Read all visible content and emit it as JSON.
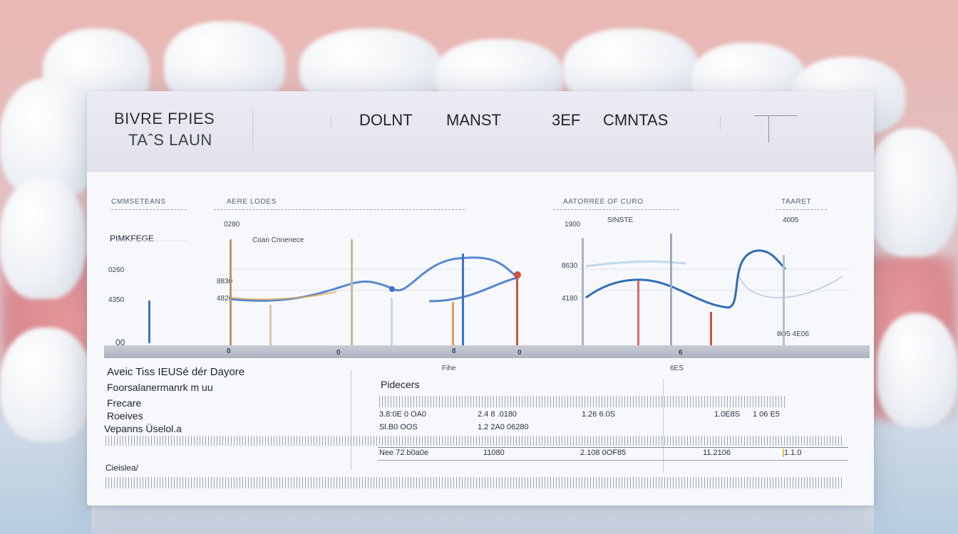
{
  "header": {
    "title_line1": "BIVRE FPIES",
    "title_line2": "TAˆS LAUN",
    "menu": [
      "DOLNT",
      "MANST",
      "3EF",
      "CMNTAS"
    ]
  },
  "panels": [
    {
      "heading": "CMMSETEANS",
      "sub": "PIMKFEGE",
      "ticks": [
        "0260",
        "4350",
        "00"
      ],
      "bottom": "0"
    },
    {
      "heading": "AERE LODES",
      "sub": "Coan Cnnenece",
      "ticks": [
        "0280",
        "8830",
        "4826"
      ],
      "bottom": "6"
    },
    {
      "heading": "AATORREE OF CURO",
      "sub": "SINSTE",
      "ticks": [
        "1900",
        "8630",
        "4180"
      ],
      "bottom": "8"
    },
    {
      "heading": "TAARET",
      "sub": "4005",
      "ticks": [
        "8O5 4E06"
      ],
      "bottom": ""
    }
  ],
  "axis_labels": [
    "0",
    "0",
    "8",
    "0",
    "6"
  ],
  "caption_mid": "Fihe",
  "caption_right": "6ES",
  "side_labels": {
    "line1": "Aveic Tiss IEUSé dér Dayore",
    "line2": "Foorsalanermanrk m uu",
    "line3": "Frecare",
    "line4": "Roeives",
    "line5": "Vepanns Üselol.a",
    "footer": "Cieislea/"
  },
  "table": {
    "heading": "Pidecers",
    "rows": [
      [
        "3.8:0E 0 OA0",
        "2.4 8 .0180",
        "1.26 6.0S",
        "1.0E8S",
        "1 06 E5"
      ],
      [
        "Sl.B0 OOS",
        "1.2 2A0 06280",
        "",
        "",
        ""
      ],
      [
        "Nee 72.b0a0e",
        "11080",
        "2.108 0OF85",
        "11.2106",
        "1.1.0"
      ]
    ]
  },
  "colors": {
    "curve": "#2f6db6",
    "accent_red": "#d0513e",
    "accent_orange": "#e3a23a",
    "accent_blue": "#3b74c9"
  }
}
